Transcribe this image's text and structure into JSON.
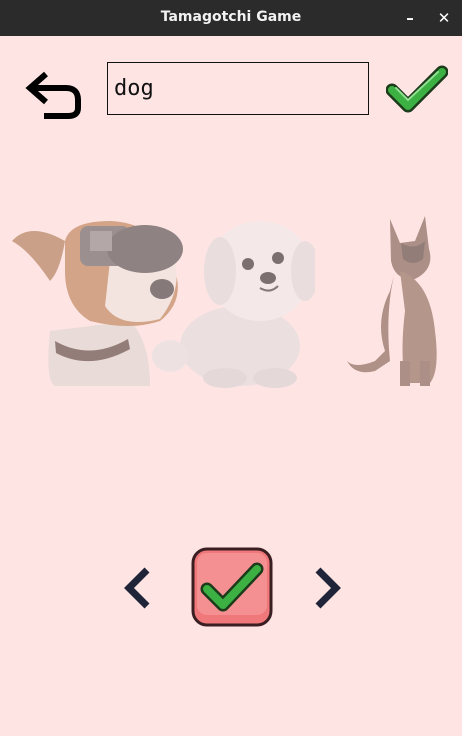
{
  "window": {
    "title": "Tamagotchi Game",
    "minimize_label": "–",
    "close_label": "✕"
  },
  "search": {
    "value": "dog"
  },
  "icons": {
    "back": "back-arrow-icon",
    "confirm": "green-check-icon",
    "prev": "chevron-left-icon",
    "next": "chevron-right-icon"
  },
  "colors": {
    "background": "#ffe4e4",
    "titlebar": "#2b2b2b",
    "check_green": "#3cb043",
    "select_button": "#f0787a"
  },
  "pets": [
    {
      "name": "dog-with-sunglasses"
    },
    {
      "name": "white-fluffy-dog"
    },
    {
      "name": "german-shepherd-dog"
    }
  ]
}
